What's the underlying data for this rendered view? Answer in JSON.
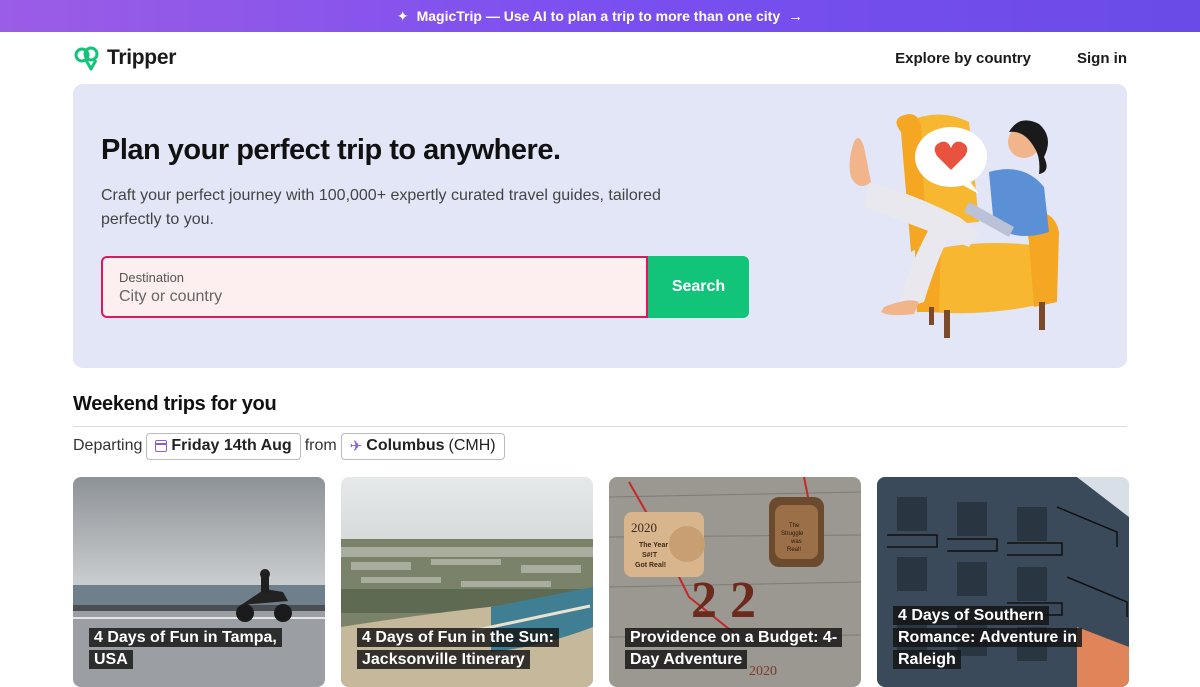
{
  "promo": {
    "text": "MagicTrip — Use AI to plan a trip to more than one city",
    "sparkle_icon": "sparkle-icon",
    "arrow_icon": "arrow-right-icon"
  },
  "header": {
    "brand": "Tripper",
    "nav": {
      "explore": "Explore by country",
      "signin": "Sign in"
    }
  },
  "hero": {
    "title": "Plan your perfect trip to anywhere.",
    "subtitle": "Craft your perfect journey with 100,000+ expertly curated travel guides, tailored perfectly to you.",
    "search": {
      "label": "Destination",
      "placeholder": "City or country",
      "button": "Search"
    }
  },
  "weekend": {
    "title": "Weekend trips for you",
    "departing_label": "Departing",
    "date": "Friday 14th Aug",
    "from_label": "from",
    "origin_city": "Columbus",
    "origin_code": "(CMH)"
  },
  "cards": [
    {
      "title": "4 Days of Fun in Tampa, USA"
    },
    {
      "title": "4 Days of Fun in the Sun: Jacksonville Itinerary"
    },
    {
      "title": "Providence on a Budget: 4-Day Adventure"
    },
    {
      "title": "4 Days of Southern Romance: Adventure in Raleigh"
    }
  ],
  "card_image_text": {
    "ornament_1_year": "2020",
    "ornament_1_line1": "The Year",
    "ornament_1_line2": "S#!T",
    "ornament_1_line3": "Got Real!",
    "ornament_2_line1": "The",
    "ornament_2_line2": "Struggle",
    "ornament_2_line3": "was",
    "ornament_2_line4": "Real!",
    "big_digits": "2 2",
    "bottom_year": "2020"
  },
  "colors": {
    "promo": "#7b4ff0",
    "brand_green": "#12c47a",
    "hero_bg": "#e2e6f7",
    "search_border": "#d81b60",
    "search_bg": "#fdeef0"
  }
}
